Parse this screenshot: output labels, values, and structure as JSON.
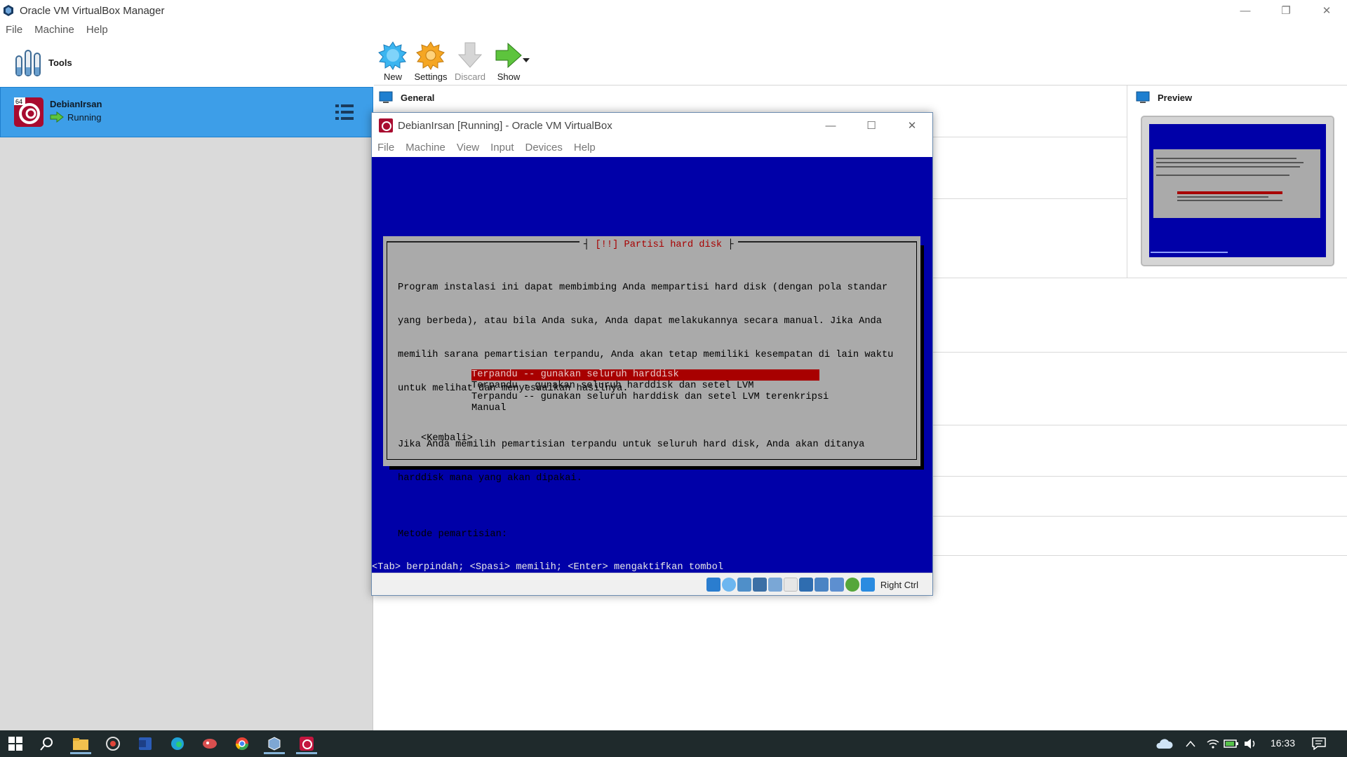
{
  "manager": {
    "title": "Oracle VM VirtualBox Manager",
    "menu": [
      "File",
      "Machine",
      "Help"
    ],
    "window_controls": [
      "—",
      "❐",
      "✕"
    ]
  },
  "left": {
    "tools_label": "Tools",
    "vm": {
      "name": "DebianIrsan",
      "status": "Running",
      "badge": "64"
    }
  },
  "toolbar": {
    "new_label": "New",
    "settings_label": "Settings",
    "discard_label": "Discard",
    "show_label": "Show"
  },
  "details": {
    "general_label": "General",
    "preview_label": "Preview"
  },
  "vm_window": {
    "title": "DebianIrsan [Running] - Oracle VM VirtualBox",
    "menu": [
      "File",
      "Machine",
      "View",
      "Input",
      "Devices",
      "Help"
    ],
    "host_key": "Right Ctrl"
  },
  "installer": {
    "dialog_title": "[!!] Partisi hard disk",
    "body_lines": [
      "Program instalasi ini dapat membimbing Anda mempartisi hard disk (dengan pola standar",
      "yang berbeda), atau bila Anda suka, Anda dapat melakukannya secara manual. Jika Anda",
      "memilih sarana pemartisian terpandu, Anda akan tetap memiliki kesempatan di lain waktu",
      "untuk melihat dan menyesuaikan hasilnya.",
      "",
      "Jika Anda memilih pemartisian terpandu untuk seluruh hard disk, Anda akan ditanya",
      "harddisk mana yang akan dipakai.",
      "",
      "Metode pemartisian:"
    ],
    "options": [
      "Terpandu -- gunakan seluruh harddisk",
      "Terpandu - gunakan seluruh harddisk dan setel LVM",
      "Terpandu -- gunakan seluruh harddisk dan setel LVM terenkripsi",
      "Manual"
    ],
    "selected_index": 0,
    "back_label": "<Kembali>",
    "footer": "<Tab> berpindah; <Spasi> memilih; <Enter> mengaktifkan tombol"
  },
  "taskbar": {
    "clock": "16:33"
  },
  "colors": {
    "console_blue": "#0000a8",
    "dialog_gray": "#aaaaaa",
    "selection_red": "#a80000",
    "vm_selected": "#3d9ee8"
  }
}
